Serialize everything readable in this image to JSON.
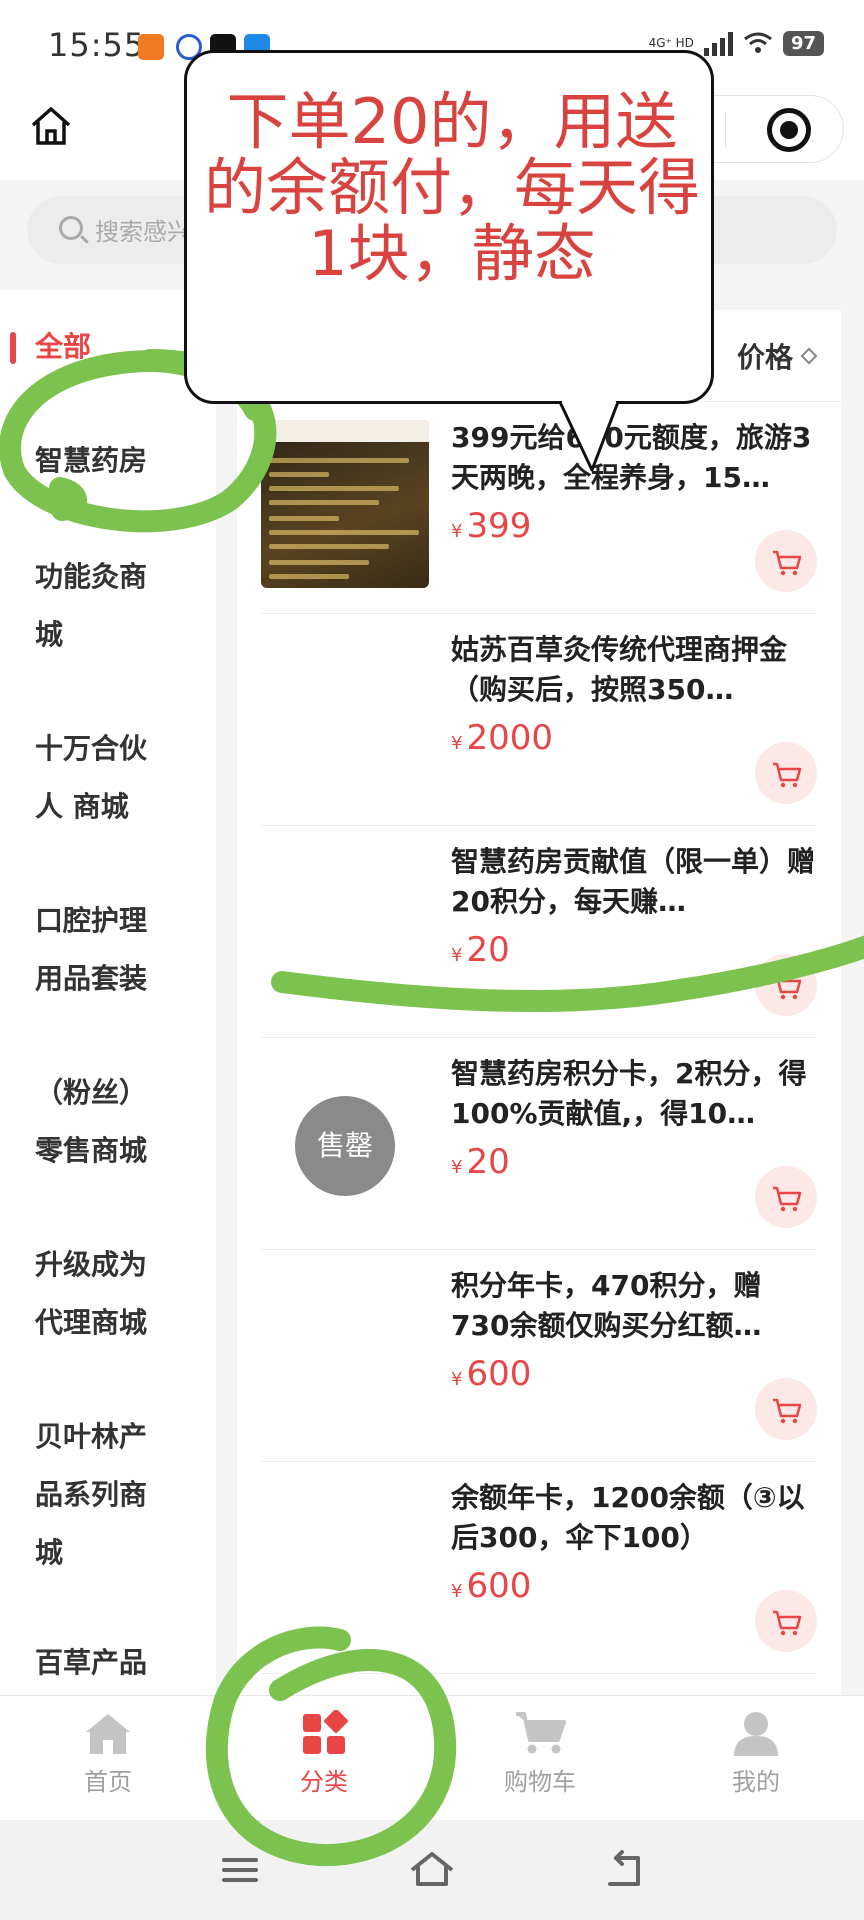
{
  "status_bar": {
    "time": "15:55",
    "network": "4G⁺ HD",
    "battery": "97"
  },
  "header": {
    "home_icon": "home-icon",
    "capsule_icon": "target-icon"
  },
  "search": {
    "placeholder": "搜索感兴趣的商品"
  },
  "sidebar": {
    "items": [
      {
        "label": "全部",
        "active": true
      },
      {
        "label": "智慧药房",
        "active": false
      },
      {
        "label": "功能灸商城",
        "active": false
      },
      {
        "label": "十万合伙人 商城",
        "active": false
      },
      {
        "label": "口腔护理用品套装",
        "active": false
      },
      {
        "label": "（粉丝）零售商城",
        "active": false
      },
      {
        "label": "升级成为代理商城",
        "active": false
      },
      {
        "label": "贝叶林产品系列商城",
        "active": false
      },
      {
        "label": "百草产品",
        "active": false
      }
    ]
  },
  "sort": {
    "price_label": "价格"
  },
  "products": [
    {
      "title": "399元给600元额度，旅游3天两晚，全程养身，15…",
      "currency": "¥",
      "price": "399",
      "sold_out": false
    },
    {
      "title": "姑苏百草灸传统代理商押金（购买后，按照350…",
      "currency": "¥",
      "price": "2000",
      "sold_out": false
    },
    {
      "title": "智慧药房贡献值（限一单）赠20积分，每天赚…",
      "currency": "¥",
      "price": "20",
      "sold_out": false
    },
    {
      "title": "智慧药房积分卡，2积分，得100%贡献值,，得10…",
      "currency": "¥",
      "price": "20",
      "sold_out": true,
      "sold_label": "售罄"
    },
    {
      "title": "积分年卡，470积分，赠730余额仅购买分红额…",
      "currency": "¥",
      "price": "600",
      "sold_out": false
    },
    {
      "title": "余额年卡，1200余额（③以后300，伞下100）",
      "currency": "¥",
      "price": "600",
      "sold_out": false
    }
  ],
  "tabbar": {
    "tabs": [
      {
        "label": "首页",
        "icon": "home-icon",
        "active": false
      },
      {
        "label": "分类",
        "icon": "category-icon",
        "active": true
      },
      {
        "label": "购物车",
        "icon": "cart-icon",
        "active": false
      },
      {
        "label": "我的",
        "icon": "user-icon",
        "active": false
      }
    ]
  },
  "annotation": {
    "callout_text": "下单20的，用送的余额付，每天得1块，静态",
    "marker_color": "#7cc24e",
    "text_color": "#d9433f"
  },
  "colors": {
    "accent": "#e84545",
    "background": "#f4f4f4"
  }
}
